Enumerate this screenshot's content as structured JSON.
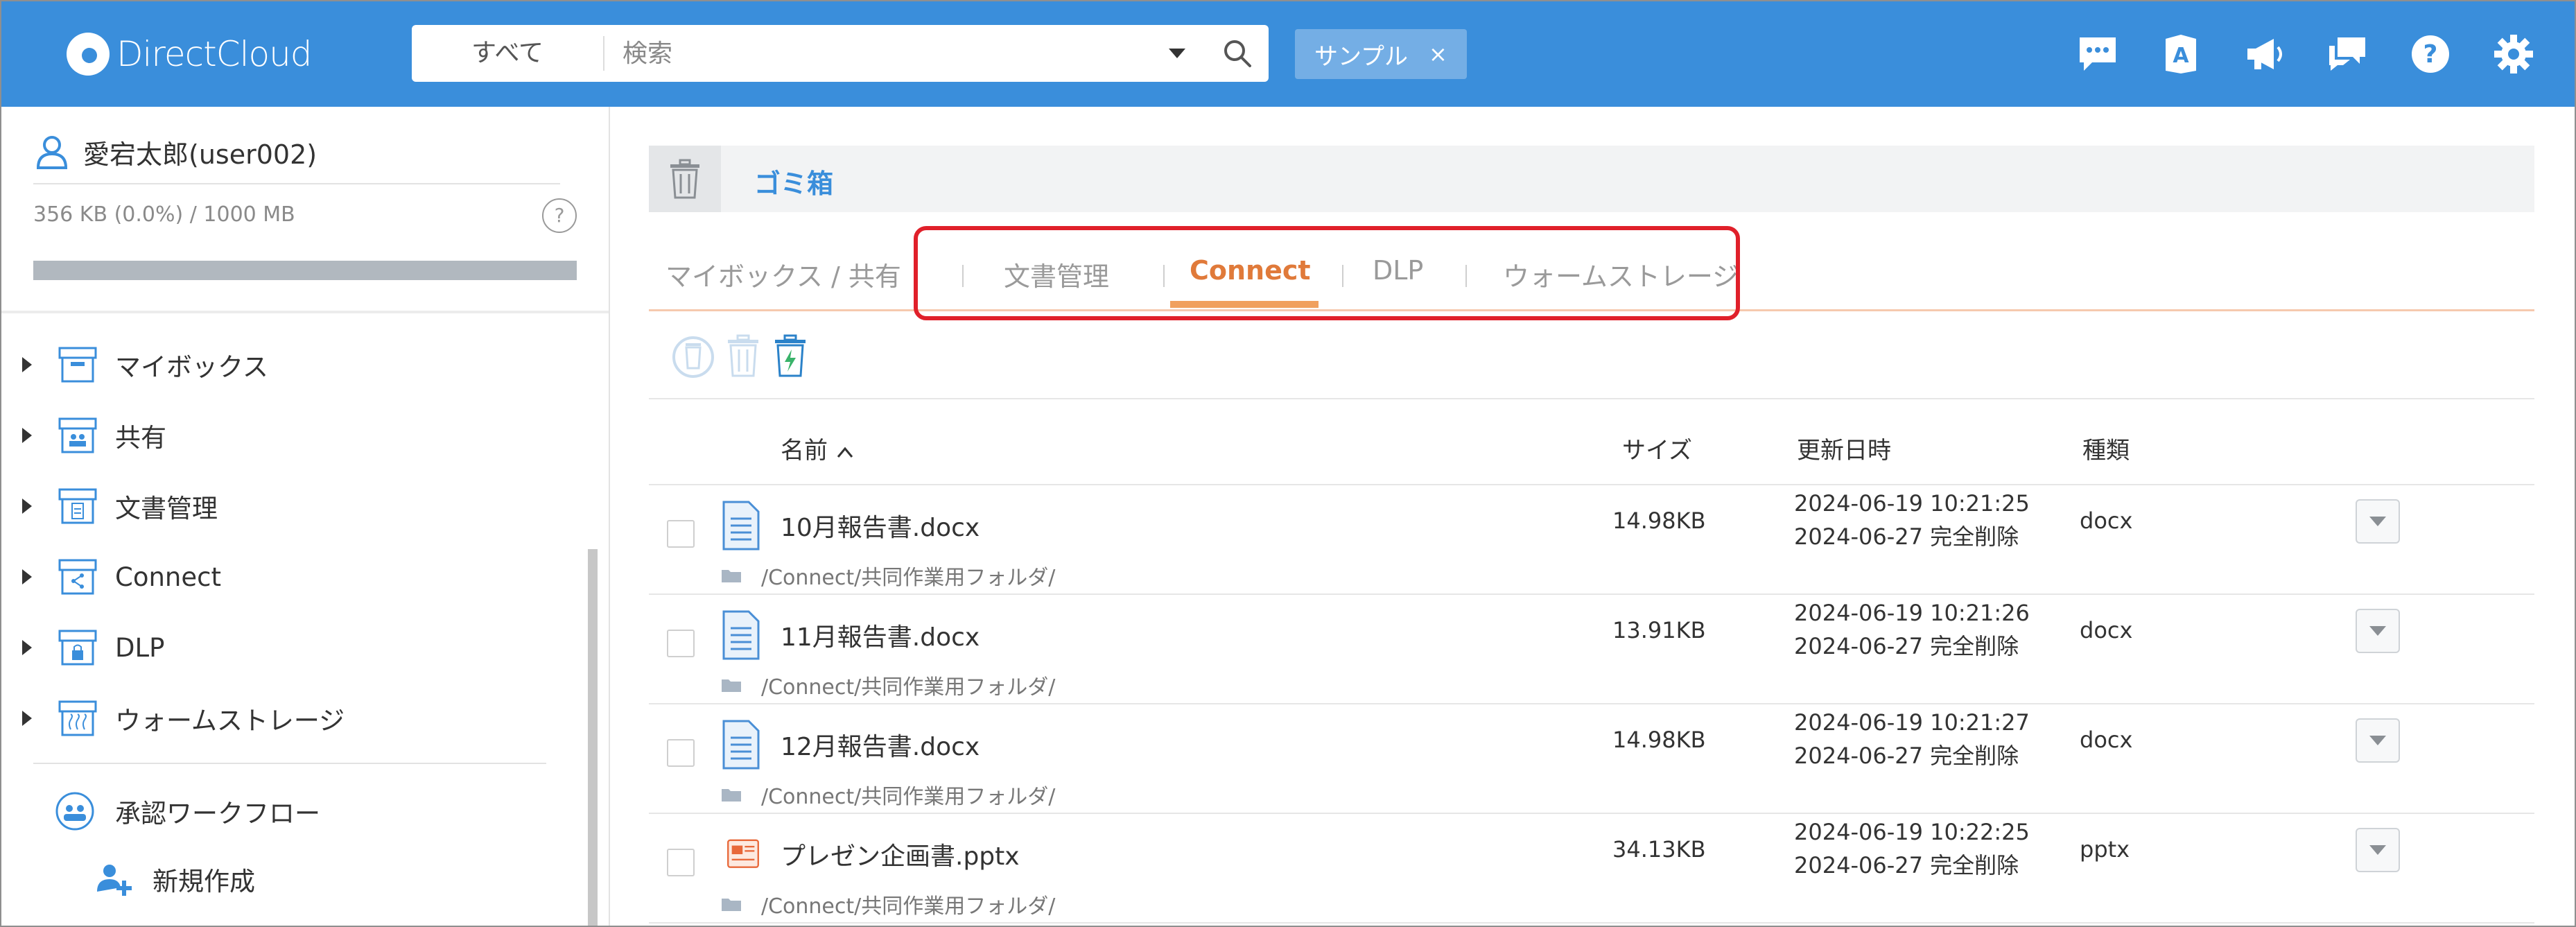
{
  "header": {
    "logo_text": "DirectCloud",
    "search_scope": "すべて",
    "search_placeholder": "検索",
    "tag_label": "サンプル",
    "tag_close": "×"
  },
  "sidebar": {
    "user_name": "愛宕太郎(user002)",
    "quota_text": "356 KB (0.0%) / 1000 MB",
    "quota_fraction": 0.0,
    "help_glyph": "?",
    "tree": [
      {
        "label": "マイボックス"
      },
      {
        "label": "共有"
      },
      {
        "label": "文書管理"
      },
      {
        "label": "Connect"
      },
      {
        "label": "DLP"
      },
      {
        "label": "ウォームストレージ"
      }
    ],
    "workflow": {
      "label": "承認ワークフロー",
      "new_label": "新規作成"
    }
  },
  "main": {
    "trash_title": "ゴミ箱",
    "tabs": [
      {
        "label": "マイボックス / 共有",
        "active": false
      },
      {
        "label": "文書管理",
        "active": false
      },
      {
        "label": "Connect",
        "active": true
      },
      {
        "label": "DLP",
        "active": false
      },
      {
        "label": "ウォームストレージ",
        "active": false
      }
    ],
    "columns": {
      "name": "名前",
      "size": "サイズ",
      "date": "更新日時",
      "type": "種類"
    },
    "files": [
      {
        "name": "10月報告書.docx",
        "path": "/Connect/共同作業用フォルダ/",
        "size": "14.98KB",
        "updated": "2024-06-19 10:21:25",
        "deleted": "2024-06-27 完全削除",
        "type": "docx",
        "icon": "word-doc-icon"
      },
      {
        "name": "11月報告書.docx",
        "path": "/Connect/共同作業用フォルダ/",
        "size": "13.91KB",
        "updated": "2024-06-19 10:21:26",
        "deleted": "2024-06-27 完全削除",
        "type": "docx",
        "icon": "word-doc-icon"
      },
      {
        "name": "12月報告書.docx",
        "path": "/Connect/共同作業用フォルダ/",
        "size": "14.98KB",
        "updated": "2024-06-19 10:21:27",
        "deleted": "2024-06-27 完全削除",
        "type": "docx",
        "icon": "word-doc-icon"
      },
      {
        "name": "プレゼン企画書.pptx",
        "path": "/Connect/共同作業用フォルダ/",
        "size": "34.13KB",
        "updated": "2024-06-19 10:22:25",
        "deleted": "2024-06-27 完全削除",
        "type": "pptx",
        "icon": "powerpoint-icon"
      }
    ]
  },
  "colors": {
    "header_blue": "#3a8edb",
    "active_tab": "#e07a3a",
    "highlight_red": "#e0202a"
  }
}
